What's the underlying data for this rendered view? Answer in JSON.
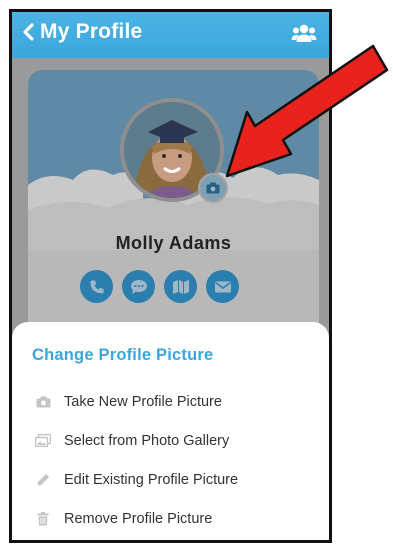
{
  "header": {
    "back_icon": "chevron-left-icon",
    "title": "My Profile",
    "group_icon": "users-icon"
  },
  "profile": {
    "name": "Molly Adams",
    "camera_icon": "camera-icon",
    "contact_actions": [
      {
        "icon": "phone-icon"
      },
      {
        "icon": "chat-icon"
      },
      {
        "icon": "map-icon"
      },
      {
        "icon": "envelope-icon"
      }
    ]
  },
  "sheet": {
    "title": "Change Profile Picture",
    "items": [
      {
        "icon": "camera-icon",
        "label": "Take New Profile Picture"
      },
      {
        "icon": "gallery-icon",
        "label": "Select from Photo Gallery"
      },
      {
        "icon": "pencil-icon",
        "label": "Edit Existing Profile Picture"
      },
      {
        "icon": "trash-icon",
        "label": "Remove Profile Picture"
      }
    ]
  },
  "colors": {
    "accent": "#3ca6dc",
    "contact_button": "#2a7fae",
    "annotation_arrow": "#e8231d",
    "overlay_dim": "#9a9a9a"
  }
}
